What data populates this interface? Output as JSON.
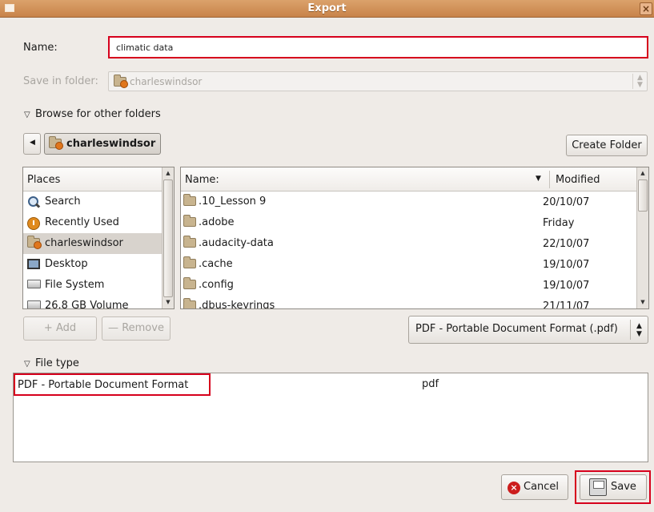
{
  "window": {
    "title": "Export"
  },
  "name_field": {
    "label": "Name:",
    "value": "climatic data"
  },
  "save_in": {
    "label": "Save in folder:",
    "value": "charleswindsor"
  },
  "browse": {
    "label": "Browse for other folders"
  },
  "path_bar": {
    "current": "charleswindsor",
    "create_folder_label": "Create Folder"
  },
  "places": {
    "header": "Places",
    "items": [
      {
        "label": "Search",
        "icon": "search-icon"
      },
      {
        "label": "Recently Used",
        "icon": "recently-used-icon"
      },
      {
        "label": "charleswindsor",
        "icon": "home-folder-icon",
        "selected": true
      },
      {
        "label": "Desktop",
        "icon": "desktop-icon"
      },
      {
        "label": "File System",
        "icon": "drive-icon"
      },
      {
        "label": "26.8 GB Volume",
        "icon": "drive-icon"
      }
    ]
  },
  "files": {
    "columns": {
      "name": "Name:",
      "modified": "Modified"
    },
    "rows": [
      {
        "name": ".10_Lesson 9",
        "modified": "20/10/07"
      },
      {
        "name": ".adobe",
        "modified": "Friday"
      },
      {
        "name": ".audacity-data",
        "modified": "22/10/07"
      },
      {
        "name": ".cache",
        "modified": "19/10/07"
      },
      {
        "name": ".config",
        "modified": "19/10/07"
      },
      {
        "name": ".dbus-keyrings",
        "modified": "21/11/07"
      }
    ]
  },
  "bookmarks": {
    "add_label": "Add",
    "remove_label": "Remove"
  },
  "filter": {
    "selected": "PDF - Portable Document Format (.pdf)"
  },
  "file_type": {
    "label": "File type",
    "rows": [
      {
        "name": "PDF - Portable Document Format",
        "ext": "pdf"
      }
    ]
  },
  "actions": {
    "cancel_label": "Cancel",
    "save_label": "Save"
  },
  "colors": {
    "titlebar": "#c8834a",
    "highlight": "#d6001c",
    "selected_row": "#d8d3cd"
  }
}
